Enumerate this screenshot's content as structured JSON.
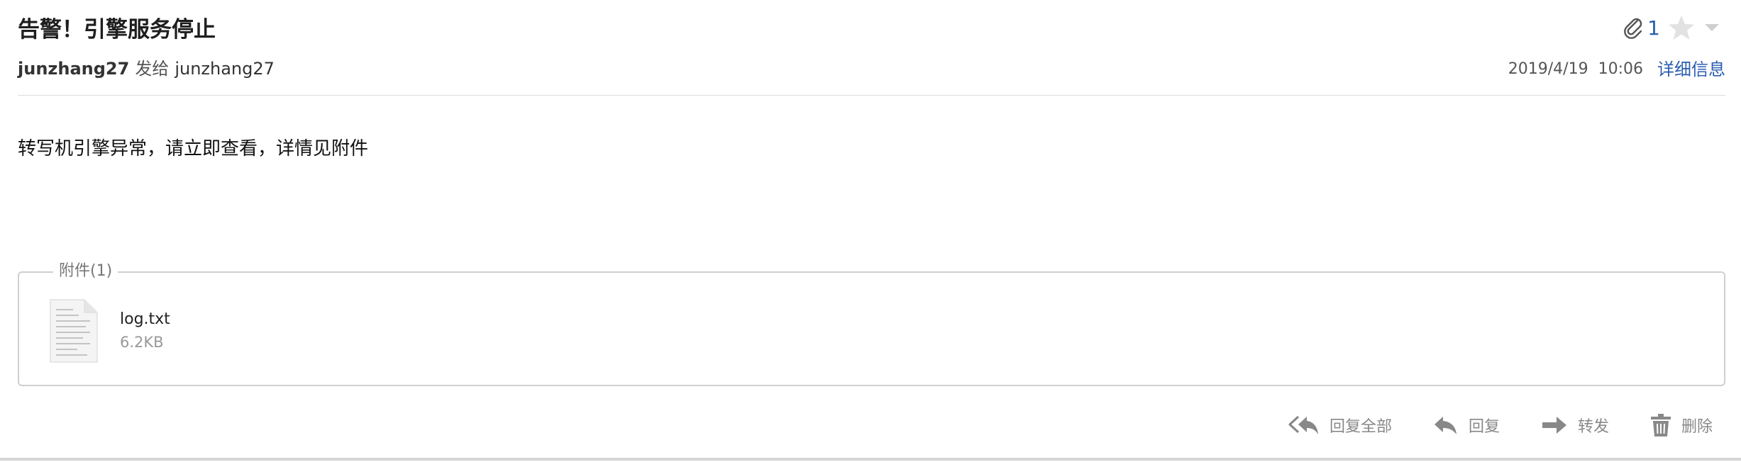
{
  "email": {
    "subject": "告警！引擎服务停止",
    "attachment_count": "1",
    "from": "junzhang27",
    "sent_to_label": "发给",
    "to": "junzhang27",
    "date": "2019/4/19",
    "time": "10:06",
    "details_link": "详细信息",
    "body": "转写机引擎异常，请立即查看，详情见附件"
  },
  "attachments": {
    "legend": "附件(1)",
    "items": [
      {
        "name": "log.txt",
        "size": "6.2KB",
        "icon": "text-file-icon"
      }
    ]
  },
  "actions": {
    "reply_all": "回复全部",
    "reply": "回复",
    "forward": "转发",
    "delete": "删除"
  },
  "icons": {
    "attachment": "paperclip-icon",
    "star": "star-icon",
    "dropdown": "chevron-down-icon",
    "reply_all": "reply-all-icon",
    "reply": "reply-icon",
    "forward": "forward-icon",
    "delete": "trash-icon"
  },
  "colors": {
    "link": "#2a5db0",
    "muted": "#888888",
    "border": "#cfcfcf"
  }
}
